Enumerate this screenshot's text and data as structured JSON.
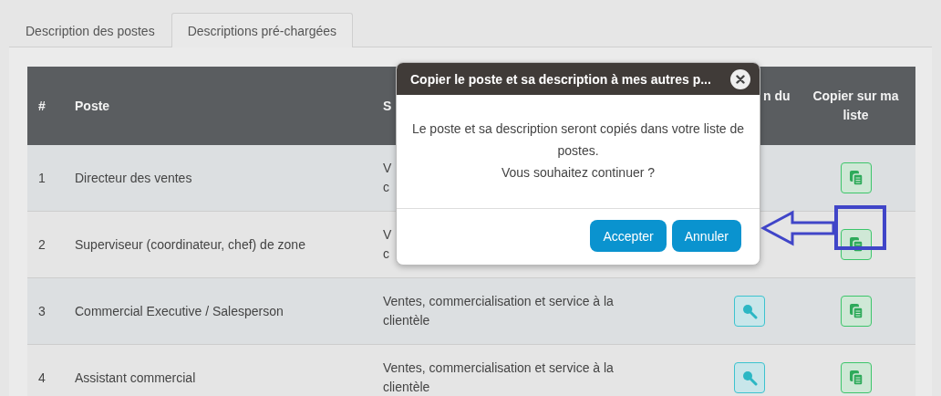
{
  "tabs": [
    {
      "label": "Description des postes",
      "selected": false
    },
    {
      "label": "Descriptions pré-chargées",
      "selected": true
    }
  ],
  "table": {
    "columns": [
      {
        "label": "#"
      },
      {
        "label": "Poste"
      },
      {
        "label": "S"
      },
      {
        "label": "n du"
      },
      {
        "label": "Copier sur ma liste"
      }
    ],
    "rows": [
      {
        "number": "1",
        "title": "Directeur des ventes",
        "sector": [
          "V",
          "c"
        ],
        "search_button": false
      },
      {
        "number": "2",
        "title": "Superviseur (coordinateur, chef) de zone",
        "sector": [
          "V",
          "c"
        ],
        "search_button": false
      },
      {
        "number": "3",
        "title": "Commercial Executive / Salesperson",
        "sector": [
          "Ventes, commercialisation et service à la",
          "clientèle"
        ],
        "search_button": true
      },
      {
        "number": "4",
        "title": "Assistant commercial",
        "sector": [
          "Ventes, commercialisation et service à la",
          "clientèle"
        ],
        "search_button": true
      }
    ]
  },
  "dialog": {
    "title": "Copier le poste et sa description à mes autres p...",
    "message": [
      "Le poste et sa description seront copiés dans votre liste de postes.",
      "Vous souhaitez continuer ?"
    ],
    "buttons": [
      "Accepter",
      "Annuler"
    ]
  }
}
